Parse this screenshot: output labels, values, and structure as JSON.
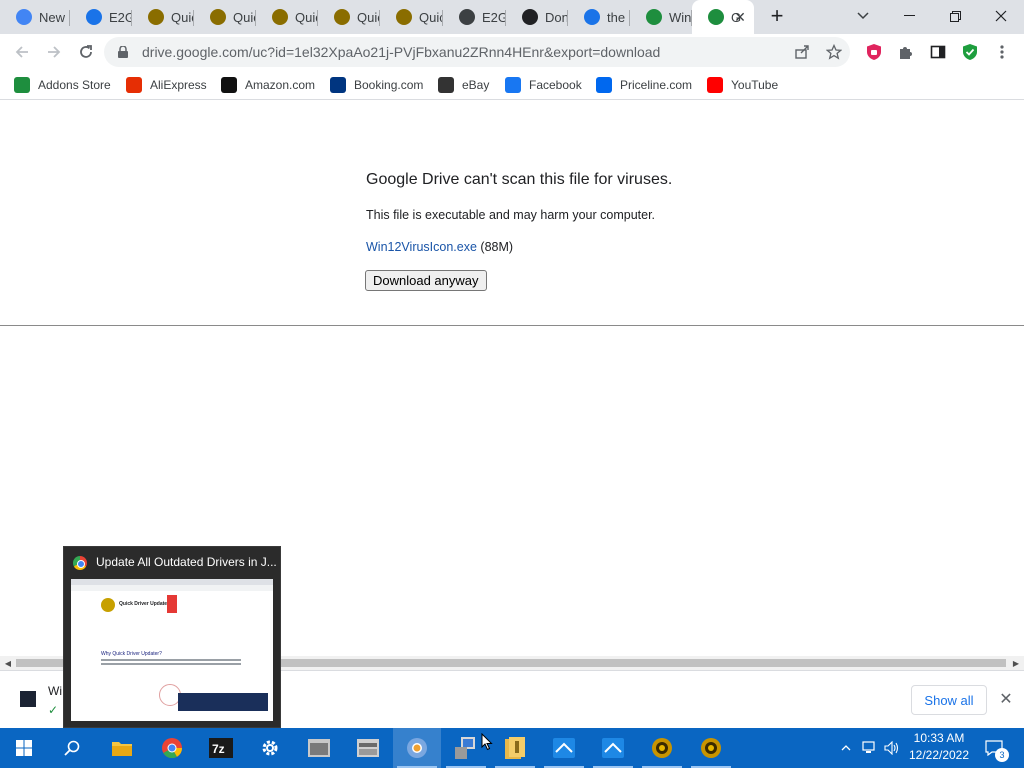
{
  "browser": {
    "tabs": [
      {
        "label": "New",
        "icon": "chrome-icon",
        "color": "#4285f4"
      },
      {
        "label": "E2G",
        "icon": "bing-icon",
        "color": "#1a73e8"
      },
      {
        "label": "Quic",
        "icon": "quick-driver-icon",
        "color": "#8a6d00"
      },
      {
        "label": "Quic",
        "icon": "quick-driver-icon",
        "color": "#8a6d00"
      },
      {
        "label": "Quic",
        "icon": "quick-driver-icon",
        "color": "#8a6d00"
      },
      {
        "label": "Quic",
        "icon": "quick-driver-icon",
        "color": "#8a6d00"
      },
      {
        "label": "Quic",
        "icon": "quick-driver-icon",
        "color": "#8a6d00"
      },
      {
        "label": "E2G",
        "icon": "globe-icon",
        "color": "#3c4043"
      },
      {
        "label": "Don",
        "icon": "archive-icon",
        "color": "#202124"
      },
      {
        "label": "the",
        "icon": "search-icon",
        "color": "#1a73e8"
      },
      {
        "label": "Win",
        "icon": "google-drive-icon",
        "color": "#1e8e3e"
      },
      {
        "label": "G",
        "icon": "google-drive-icon",
        "color": "#1e8e3e"
      }
    ],
    "new_tab": "+",
    "url": "drive.google.com/uc?id=1el32XpaAo21j-PVjFbxanu2ZRnn4HEnr&export=download",
    "bookmarks": [
      {
        "label": "Addons Store",
        "icon": "addons-store-icon",
        "color": "#1e8e3e"
      },
      {
        "label": "AliExpress",
        "icon": "aliexpress-icon",
        "color": "#e62e04"
      },
      {
        "label": "Amazon.com",
        "icon": "amazon-icon",
        "color": "#111111"
      },
      {
        "label": "Booking.com",
        "icon": "booking-icon",
        "color": "#003580"
      },
      {
        "label": "eBay",
        "icon": "ebay-icon",
        "color": "#333333"
      },
      {
        "label": "Facebook",
        "icon": "facebook-icon",
        "color": "#1877f2"
      },
      {
        "label": "Priceline.com",
        "icon": "priceline-icon",
        "color": "#0068ef"
      },
      {
        "label": "YouTube",
        "icon": "youtube-icon",
        "color": "#ff0000"
      }
    ]
  },
  "page": {
    "title": "Google Drive can't scan this file for viruses.",
    "message": "This file is executable and may harm your computer.",
    "file_name": "Win12VirusIcon.exe",
    "file_size": "(88M)",
    "download_button": "Download anyway"
  },
  "download_shelf": {
    "item_name": "Wi",
    "show_all": "Show all",
    "close": "✕"
  },
  "taskbar_preview": {
    "title": "Update All Outdated Drivers in J...",
    "preview_app_name": "Quick Driver Updater",
    "preview_heading": "Why Quick Driver Updater?"
  },
  "taskbar": {
    "accent": "#0a66c2",
    "items": [
      "start-button",
      "search-button",
      "file-explorer",
      "chrome",
      "7zip",
      "settings",
      "app-window-1",
      "app-window-2",
      "chromium-browser",
      "app-installer",
      "file-archive",
      "app-blue-1",
      "app-blue-2",
      "quick-driver-1",
      "quick-driver-2"
    ],
    "time": "10:33 AM",
    "date": "12/22/2022",
    "notifications": "3"
  }
}
